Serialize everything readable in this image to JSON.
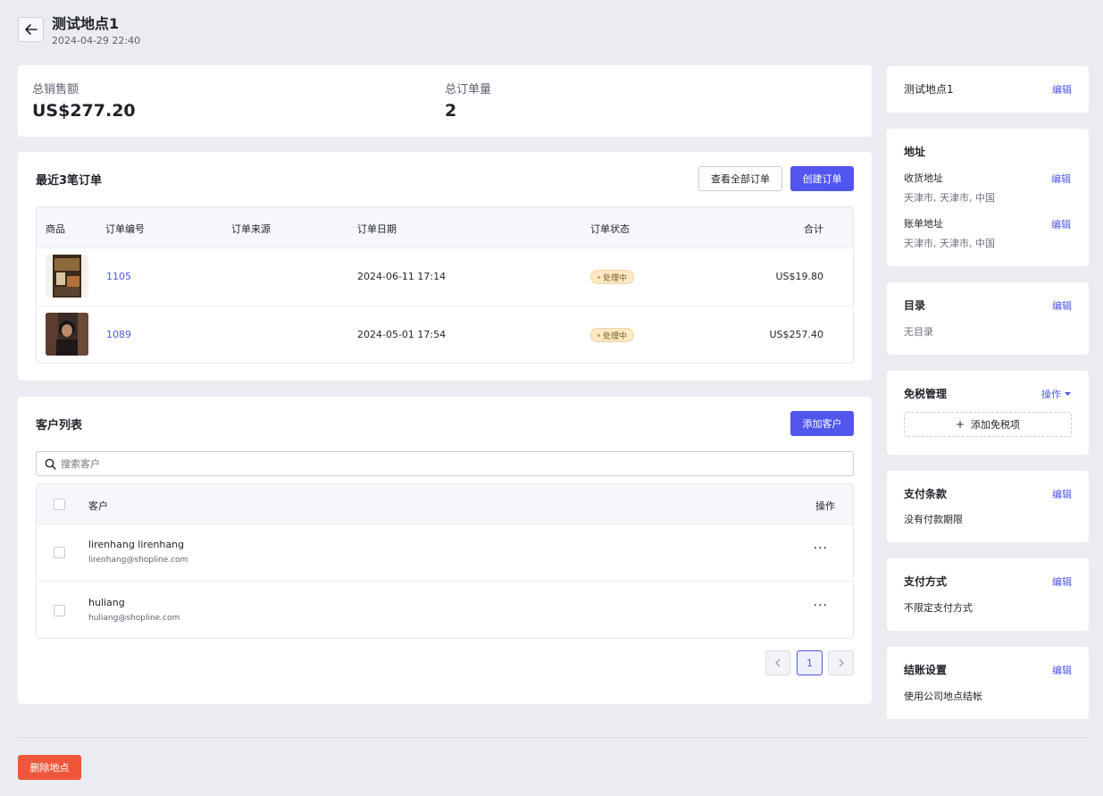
{
  "header": {
    "title": "测试地点1",
    "date": "2024-04-29 22:40"
  },
  "stats": {
    "sales_label": "总销售额",
    "sales_value": "US$277.20",
    "orders_label": "总订单量",
    "orders_value": "2"
  },
  "recent_orders": {
    "title": "最近3笔订单",
    "view_all_label": "查看全部订单",
    "create_label": "创建订单",
    "columns": [
      "商品",
      "订单编号",
      "订单来源",
      "订单日期",
      "订单状态",
      "合计"
    ],
    "rows": [
      {
        "order_no": "1105",
        "source": "",
        "date": "2024-06-11 17:14",
        "status": "处理中",
        "total": "US$19.80"
      },
      {
        "order_no": "1089",
        "source": "",
        "date": "2024-05-01 17:54",
        "status": "处理中",
        "total": "US$257.40"
      }
    ]
  },
  "customers": {
    "title": "客户列表",
    "add_label": "添加客户",
    "search_placeholder": "搜索客户",
    "col_customer": "客户",
    "col_action": "操作",
    "rows": [
      {
        "name": "lirenhang lirenhang",
        "email": "lirenhang@shopline.com",
        "more": "···"
      },
      {
        "name": "huliang",
        "email": "huliang@shopline.com",
        "more": "···"
      }
    ],
    "pagination": {
      "current": "1"
    }
  },
  "sidebar": {
    "location": {
      "title": "测试地点1",
      "edit": "编辑"
    },
    "address": {
      "title": "地址",
      "shipping_label": "收货地址",
      "shipping_value": "天津市, 天津市, 中国",
      "billing_label": "账单地址",
      "billing_value": "天津市, 天津市, 中国",
      "edit": "编辑"
    },
    "catalog": {
      "title": "目录",
      "value": "无目录",
      "edit": "编辑"
    },
    "tax": {
      "title": "免税管理",
      "action": "操作",
      "add_label": "添加免税项"
    },
    "payment_terms": {
      "title": "支付条款",
      "value": "没有付款期限",
      "edit": "编辑"
    },
    "payment_method": {
      "title": "支付方式",
      "value": "不限定支付方式",
      "edit": "编辑"
    },
    "checkout": {
      "title": "结账设置",
      "value": "使用公司地点结帐",
      "edit": "编辑"
    }
  },
  "footer": {
    "delete_label": "删除地点"
  },
  "colors": {
    "primary": "#5056ee",
    "danger": "#f0573a",
    "link": "#4b57e6",
    "background": "#eaecf1"
  }
}
